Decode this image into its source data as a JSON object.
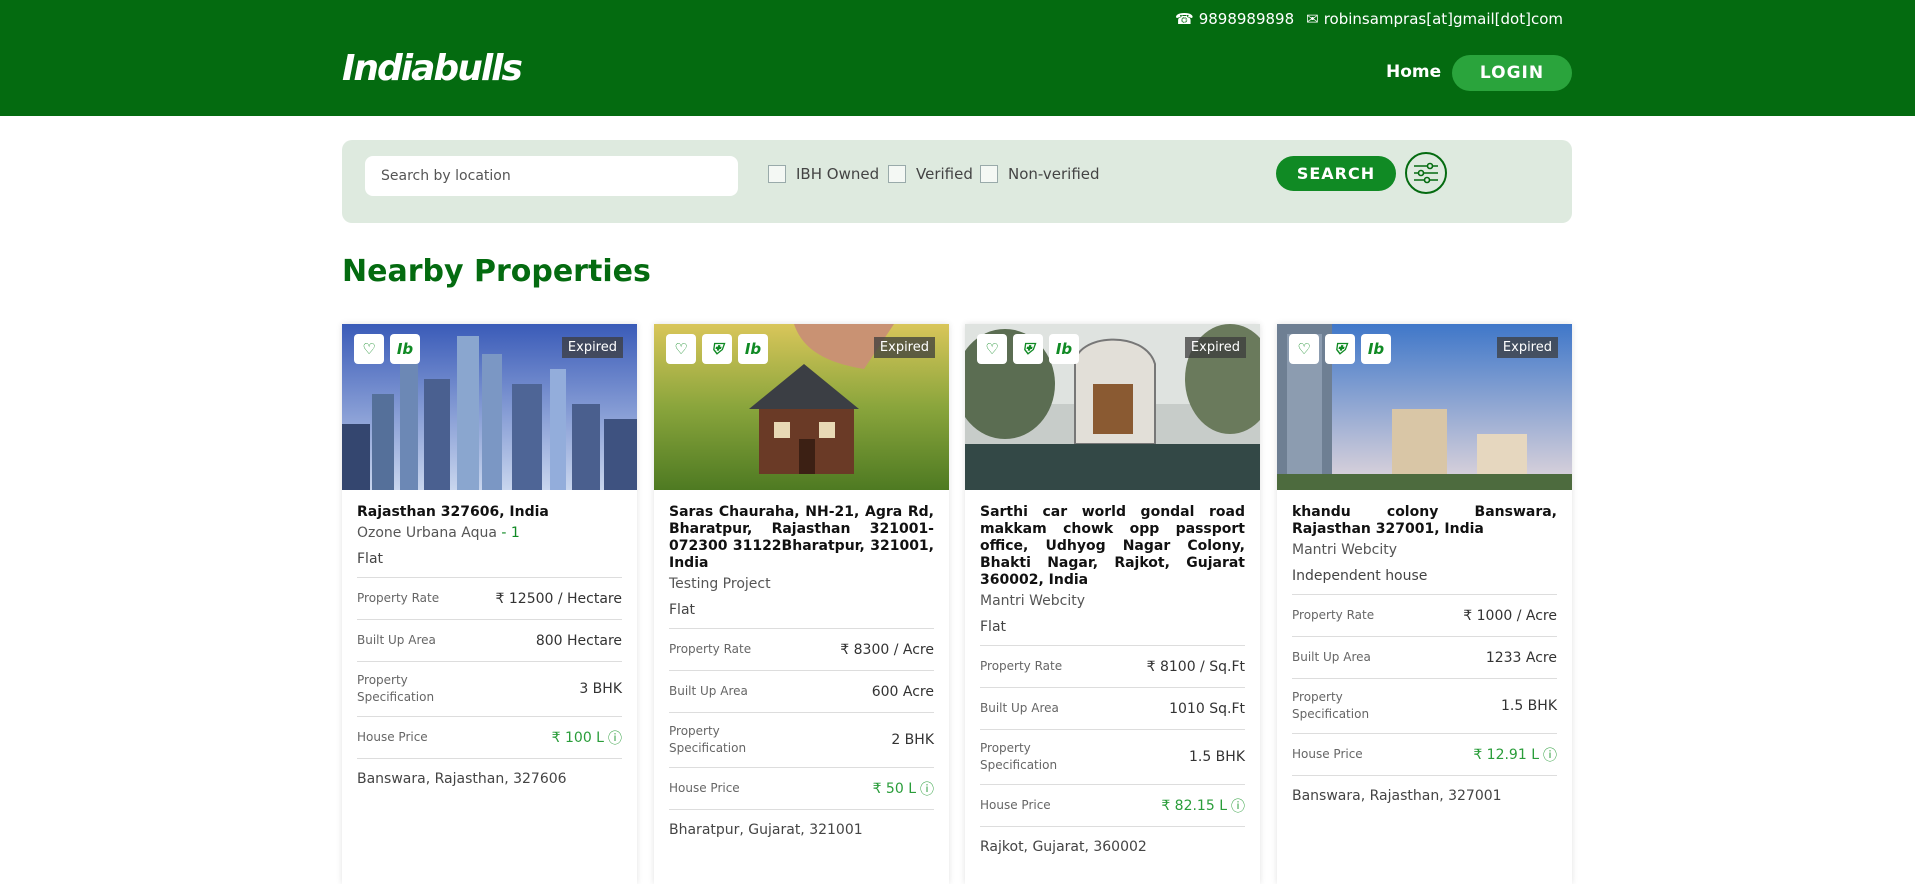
{
  "header": {
    "phone": "9898989898",
    "email": "robinsampras[at]gmail[dot]com",
    "logo": "Indiabulls",
    "home_label": "Home",
    "login_label": "LOGIN",
    "colors": {
      "primary": "#046b10",
      "accent": "#2aa43c"
    }
  },
  "search": {
    "placeholder": "Search by location",
    "value": "",
    "filters": [
      "IBH Owned",
      "Verified",
      "Non-verified"
    ],
    "button_label": "SEARCH"
  },
  "section_title": "Nearby Properties",
  "properties": [
    {
      "status": "Expired",
      "address": "Rajasthan 327606, India",
      "project": "Ozone Urbana Aqua",
      "project_suffix": " - 1",
      "type": "Flat",
      "rate_label": "Property Rate",
      "rate": "₹ 12500 / Hectare",
      "area_label": "Built Up Area",
      "area": "800 Hectare",
      "spec_label": "Property Specification",
      "spec": "3 BHK",
      "price_label": "House Price",
      "price": "₹ 100 L",
      "location": "Banswara, Rajasthan, 327606"
    },
    {
      "status": "Expired",
      "address": "Saras Chauraha, NH-21, Agra Rd, Bharatpur, Rajasthan 321001-072300 31122Bharatpur, 321001, India",
      "project": "Testing Project",
      "project_suffix": "",
      "type": "Flat",
      "rate_label": "Property Rate",
      "rate": "₹ 8300 / Acre",
      "area_label": "Built Up Area",
      "area": "600 Acre",
      "spec_label": "Property Specification",
      "spec": "2 BHK",
      "price_label": "House Price",
      "price": "₹ 50 L",
      "location": "Bharatpur, Gujarat, 321001"
    },
    {
      "status": "Expired",
      "address": "Sarthi car world gondal road makkam chowk opp passport office, Udhyog Nagar Colony, Bhakti Nagar, Rajkot, Gujarat 360002, India",
      "project": "Mantri Webcity",
      "project_suffix": "",
      "type": "Flat",
      "rate_label": "Property Rate",
      "rate": "₹ 8100 / Sq.Ft",
      "area_label": "Built Up Area",
      "area": "1010 Sq.Ft",
      "spec_label": "Property Specification",
      "spec": "1.5 BHK",
      "price_label": "House Price",
      "price": "₹ 82.15 L",
      "location": "Rajkot, Gujarat, 360002"
    },
    {
      "status": "Expired",
      "address": "khandu colony Banswara, Rajasthan 327001, India",
      "project": "Mantri Webcity",
      "project_suffix": "",
      "type": "Independent house",
      "rate_label": "Property Rate",
      "rate": "₹ 1000 / Acre",
      "area_label": "Built Up Area",
      "area": "1233 Acre",
      "spec_label": "Property Specification",
      "spec": "1.5 BHK",
      "price_label": "House Price",
      "price": "₹ 12.91 L",
      "location": "Banswara, Rajasthan, 327001"
    }
  ]
}
